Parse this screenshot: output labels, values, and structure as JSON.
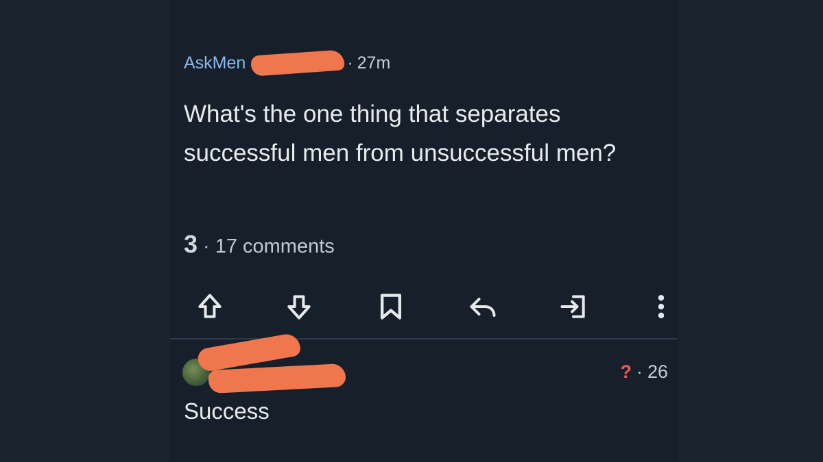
{
  "post": {
    "subreddit": "AskMen",
    "separator": "·",
    "age": "27m",
    "title": "What's the one thing that separates successful men from unsuccessful men?",
    "score": "3",
    "comments": "17 comments"
  },
  "actions": [
    {
      "name": "upvote-icon"
    },
    {
      "name": "downvote-icon"
    },
    {
      "name": "bookmark-icon"
    },
    {
      "name": "reply-icon"
    },
    {
      "name": "share-icon"
    },
    {
      "name": "more-options-icon"
    }
  ],
  "comment": {
    "score": "?",
    "separator": "·",
    "age": "26",
    "body": "Success"
  },
  "colors": {
    "background": "#17202a",
    "subreddit": "#8ab7ee",
    "text": "#e8ebee",
    "redaction": "#f0764e",
    "hidden_score": "#ef5757"
  }
}
